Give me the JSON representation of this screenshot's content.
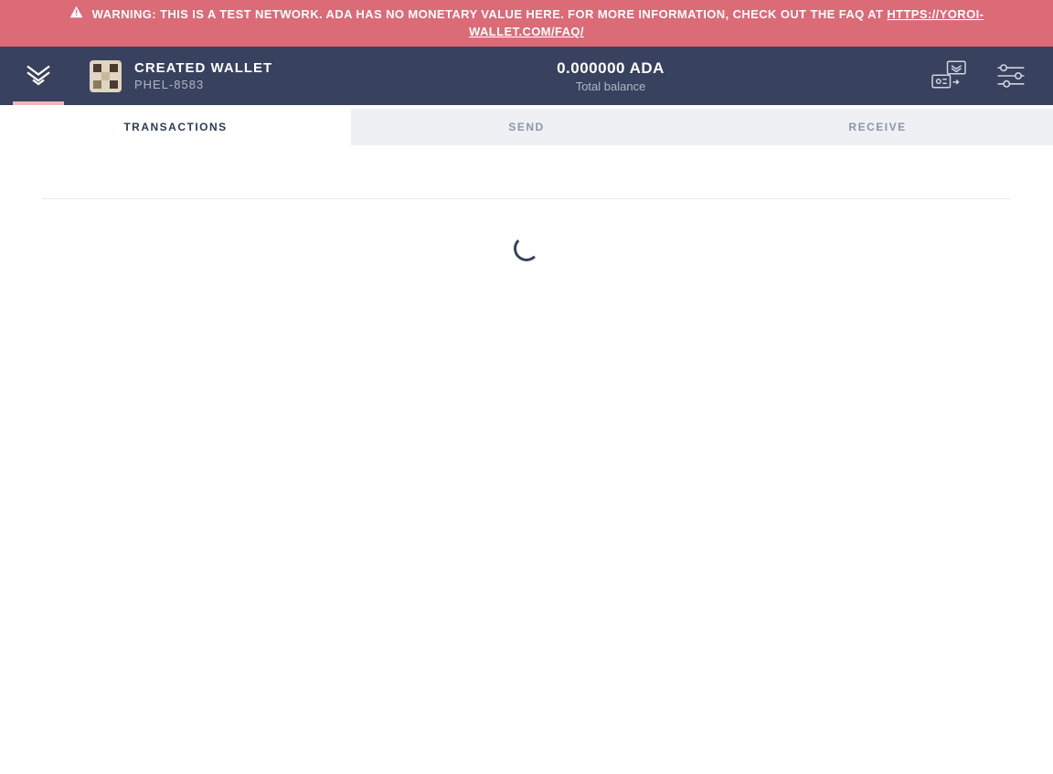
{
  "warning": {
    "text_prefix": "WARNING: THIS IS A TEST NETWORK. ADA HAS NO MONETARY VALUE HERE. FOR MORE INFORMATION, CHECK OUT THE FAQ AT ",
    "link_text": "HTTPS://YOROI-WALLET.COM/FAQ/"
  },
  "header": {
    "wallet_name": "CREATED WALLET",
    "wallet_plate": "PHEL-8583",
    "balance_amount": "0.000000 ADA",
    "balance_label": "Total balance"
  },
  "tabs": {
    "transactions": "TRANSACTIONS",
    "send": "SEND",
    "receive": "RECEIVE"
  }
}
